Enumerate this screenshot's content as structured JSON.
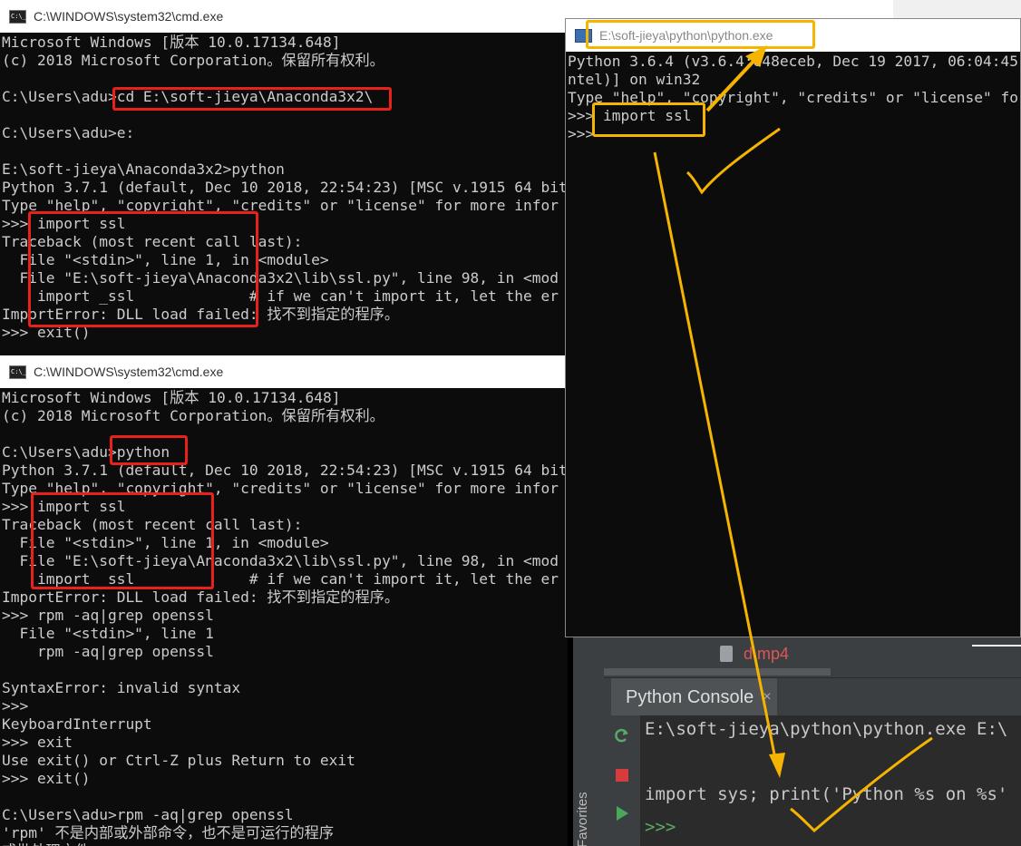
{
  "win1": {
    "title": "C:\\WINDOWS\\system32\\cmd.exe",
    "lines": [
      "Microsoft Windows [版本 10.0.17134.648]",
      "(c) 2018 Microsoft Corporation。保留所有权利。",
      "",
      "C:\\Users\\adu>cd E:\\soft-jieya\\Anaconda3x2\\",
      "",
      "C:\\Users\\adu>e:",
      "",
      "E:\\soft-jieya\\Anaconda3x2>python",
      "Python 3.7.1 (default, Dec 10 2018, 22:54:23) [MSC v.1915 64 bit",
      "Type \"help\", \"copyright\", \"credits\" or \"license\" for more infor",
      ">>> import ssl",
      "Traceback (most recent call last):",
      "  File \"<stdin>\", line 1, in <module>",
      "  File \"E:\\soft-jieya\\Anaconda3x2\\lib\\ssl.py\", line 98, in <mod",
      "    import _ssl             # if we can't import it, let the er",
      "ImportError: DLL load failed: 找不到指定的程序。",
      ">>> exit()"
    ]
  },
  "win2": {
    "title": "C:\\WINDOWS\\system32\\cmd.exe",
    "lines": [
      "Microsoft Windows [版本 10.0.17134.648]",
      "(c) 2018 Microsoft Corporation。保留所有权利。",
      "",
      "C:\\Users\\adu>python",
      "Python 3.7.1 (default, Dec 10 2018, 22:54:23) [MSC v.1915 64 bit",
      "Type \"help\", \"copyright\", \"credits\" or \"license\" for more infor",
      ">>> import ssl",
      "Traceback (most recent call last):",
      "  File \"<stdin>\", line 1, in <module>",
      "  File \"E:\\soft-jieya\\Anaconda3x2\\lib\\ssl.py\", line 98, in <mod",
      "    import _ssl             # if we can't import it, let the er",
      "ImportError: DLL load failed: 找不到指定的程序。",
      ">>> rpm -aq|grep openssl",
      "  File \"<stdin>\", line 1",
      "    rpm -aq|grep openssl",
      "",
      "SyntaxError: invalid syntax",
      ">>>",
      "KeyboardInterrupt",
      ">>> exit",
      "Use exit() or Ctrl-Z plus Return to exit",
      ">>> exit()",
      "",
      "C:\\Users\\adu>rpm -aq|grep openssl",
      "'rpm' 不是内部或外部命令，也不是可运行的程序",
      "或批处理文件。"
    ]
  },
  "win3": {
    "title": "E:\\soft-jieya\\python\\python.exe",
    "lines": [
      "Python 3.6.4 (v3.6.4:d48eceb, Dec 19 2017, 06:04:45",
      "ntel)] on win32",
      "Type \"help\", \"copyright\", \"credits\" or \"license\" fo",
      ">>> import ssl",
      ">>>"
    ]
  },
  "ide": {
    "file_name": "d.mp4",
    "tab_label": "Python Console",
    "tab_close": "×",
    "favorites": "Favorites",
    "console_lines": [
      "E:\\soft-jieya\\python\\python.exe E:\\",
      "",
      "import sys; print('Python %s on %s'",
      ">>>"
    ],
    "tools": [
      "rerun-icon",
      "stop-icon",
      "run-icon"
    ]
  },
  "colors": {
    "console_bg": "#0c0c0c",
    "console_fg": "#cccccc",
    "annotation_red": "#e8211a",
    "annotation_yellow": "#f5b400",
    "ide_bg": "#3c3f41"
  }
}
